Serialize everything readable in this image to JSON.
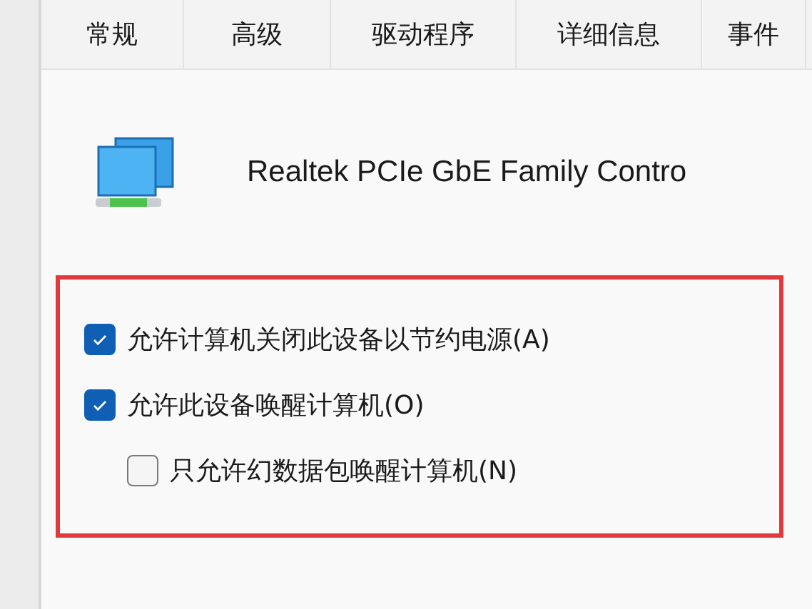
{
  "tabs": [
    {
      "label": "常规",
      "selected": false
    },
    {
      "label": "高级",
      "selected": false
    },
    {
      "label": "驱动程序",
      "selected": false
    },
    {
      "label": "详细信息",
      "selected": false
    },
    {
      "label": "事件",
      "selected": false
    }
  ],
  "device": {
    "name": "Realtek PCIe GbE Family Contro"
  },
  "highlight": {
    "color": "#e03a3e"
  },
  "options": [
    {
      "label": "允许计算机关闭此设备以节约电源(A)",
      "checked": true,
      "indented": false
    },
    {
      "label": "允许此设备唤醒计算机(O)",
      "checked": true,
      "indented": false
    },
    {
      "label": "只允许幻数据包唤醒计算机(N)",
      "checked": false,
      "indented": true
    }
  ]
}
